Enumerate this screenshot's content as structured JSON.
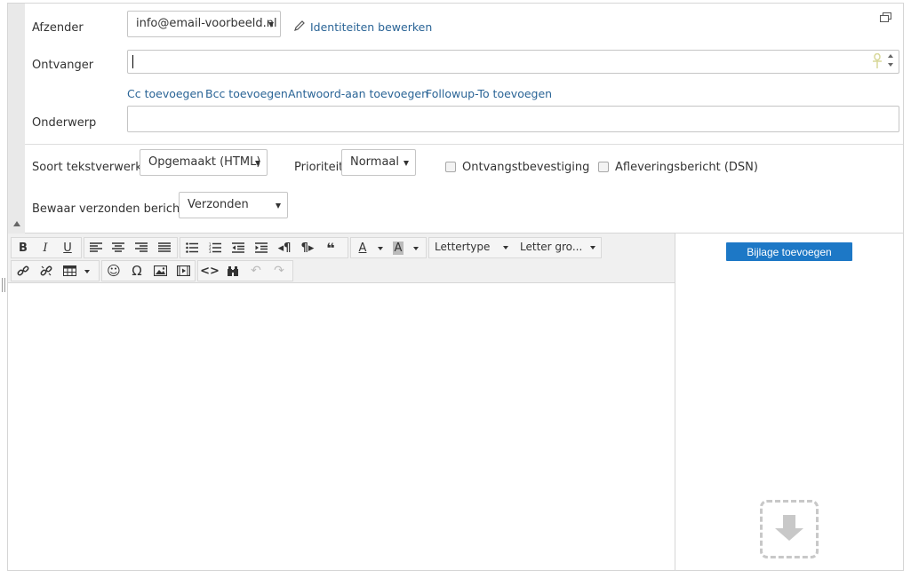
{
  "headers": {
    "from_label": "Afzender",
    "from_value": "info@email-voorbeeld.nl",
    "edit_identities": "Identiteiten bewerken",
    "to_label": "Ontvanger",
    "to_value": "",
    "add_cc": "Cc toevoegen",
    "add_bcc": "Bcc toevoegen",
    "add_reply_to": "Antwoord-aan toevoegen",
    "add_followup_to": "Followup-To toevoegen",
    "subject_label": "Onderwerp",
    "subject_value": ""
  },
  "options": {
    "editor_type_label": "Soort tekstverwerker",
    "editor_type_value": "Opgemaakt (HTML)",
    "priority_label": "Prioriteit",
    "priority_value": "Normaal",
    "receipt_label": "Ontvangstbevestiging",
    "dsn_label": "Afleveringsbericht (DSN)",
    "save_sent_label": "Bewaar verzonden bericht in",
    "save_sent_value": "Verzonden"
  },
  "toolbar": {
    "bold": "B",
    "italic": "I",
    "underline": "U",
    "font_family": "Lettertype",
    "font_size": "Letter gro..."
  },
  "attachments": {
    "add_button": "Bijlage toevoegen"
  },
  "colors": {
    "link": "#2a6496",
    "primary_button": "#1d78c6"
  }
}
